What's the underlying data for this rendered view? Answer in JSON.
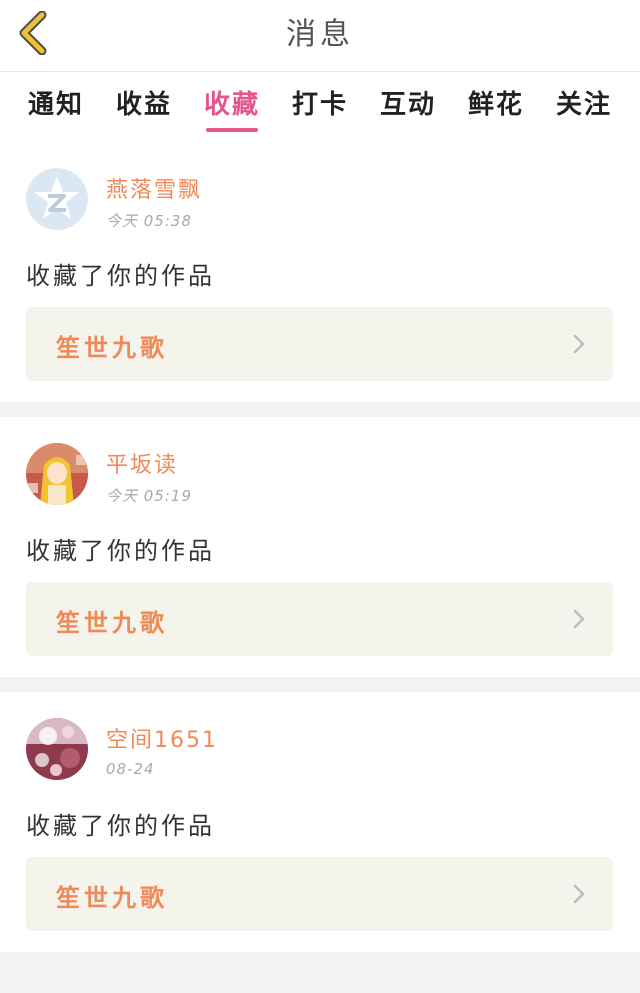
{
  "header": {
    "title": "消息",
    "back_icon": "chevron-left-icon",
    "back_color": "#f0c231"
  },
  "tabs": [
    {
      "label": "通知"
    },
    {
      "label": "收益"
    },
    {
      "label": "收藏",
      "active": true
    },
    {
      "label": "打卡"
    },
    {
      "label": "互动"
    },
    {
      "label": "鲜花"
    },
    {
      "label": "关注"
    }
  ],
  "colors": {
    "accent": "#e5558c",
    "username": "#ef8a58",
    "work_bg": "#f4f3ec"
  },
  "messages": [
    {
      "username": "燕落雪飘",
      "time": "今天 05:38",
      "action": "收藏了你的作品",
      "work_title": "笙世九歌",
      "avatar": "qq-star-avatar"
    },
    {
      "username": "平坂读",
      "time": "今天 05:19",
      "action": "收藏了你的作品",
      "work_title": "笙世九歌",
      "avatar": "anime-girl-avatar"
    },
    {
      "username": "空间1651",
      "time": "08-24",
      "action": "收藏了你的作品",
      "work_title": "笙世九歌",
      "avatar": "floral-avatar"
    }
  ]
}
